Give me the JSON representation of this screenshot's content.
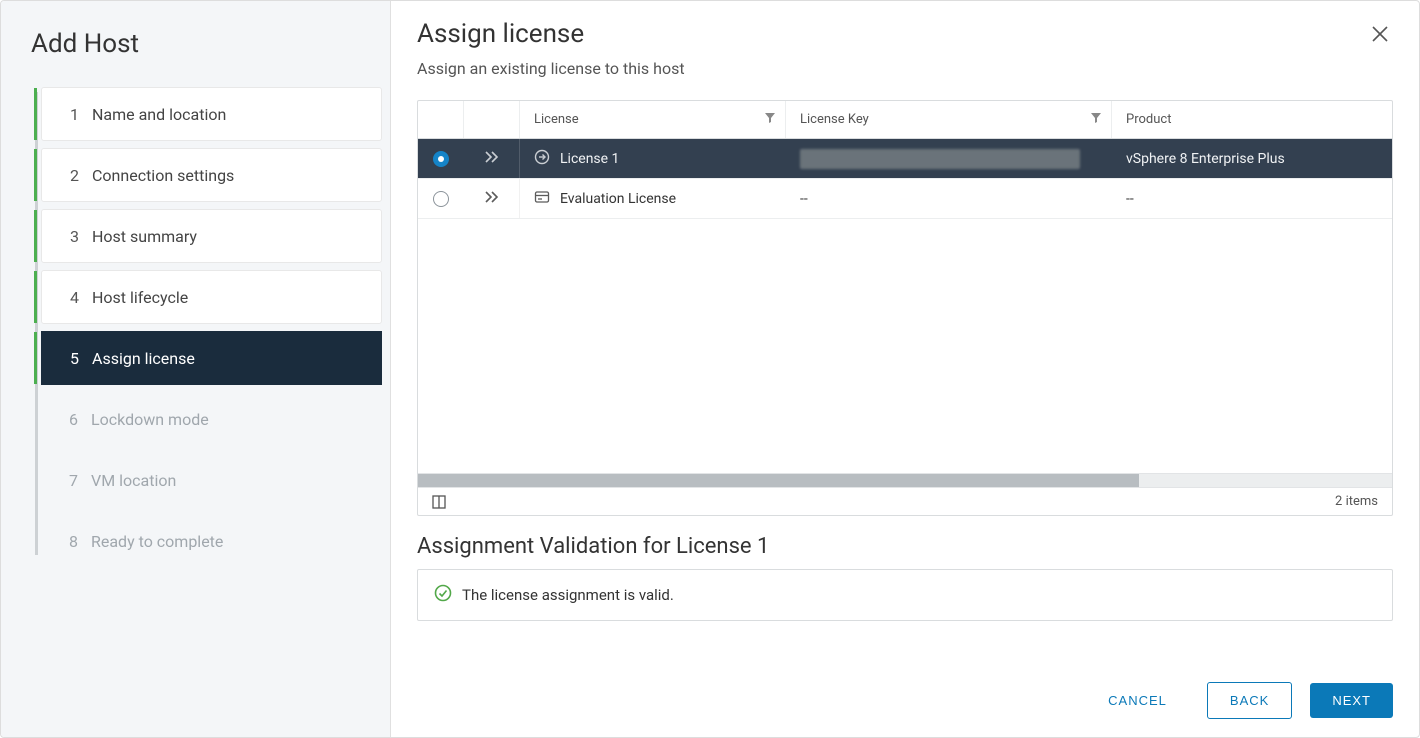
{
  "wizard": {
    "title": "Add Host",
    "steps": [
      {
        "num": "1",
        "label": "Name and location",
        "state": "completed"
      },
      {
        "num": "2",
        "label": "Connection settings",
        "state": "completed"
      },
      {
        "num": "3",
        "label": "Host summary",
        "state": "completed"
      },
      {
        "num": "4",
        "label": "Host lifecycle",
        "state": "completed"
      },
      {
        "num": "5",
        "label": "Assign license",
        "state": "current"
      },
      {
        "num": "6",
        "label": "Lockdown mode",
        "state": "future"
      },
      {
        "num": "7",
        "label": "VM location",
        "state": "future"
      },
      {
        "num": "8",
        "label": "Ready to complete",
        "state": "future"
      }
    ]
  },
  "page": {
    "title": "Assign license",
    "subtitle": "Assign an existing license to this host"
  },
  "table": {
    "columns": {
      "license": "License",
      "licenseKey": "License Key",
      "product": "Product"
    },
    "rows": [
      {
        "selected": true,
        "icon": "arrow-right-circle-icon",
        "name": "License 1",
        "key": "(redacted)",
        "product": "vSphere 8 Enterprise Plus"
      },
      {
        "selected": false,
        "icon": "card-icon",
        "name": "Evaluation License",
        "key": "--",
        "product": "--"
      }
    ],
    "footer_count": "2 items"
  },
  "validation": {
    "title": "Assignment Validation for License 1",
    "message": "The license assignment is valid."
  },
  "buttons": {
    "cancel": "CANCEL",
    "back": "BACK",
    "next": "NEXT"
  }
}
